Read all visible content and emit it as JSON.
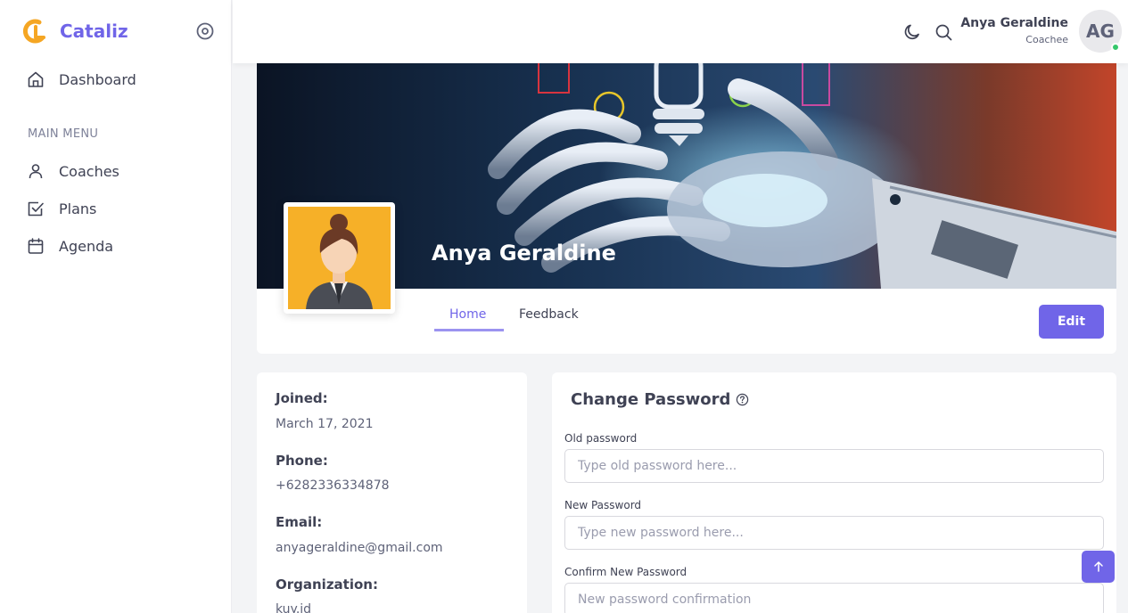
{
  "brand": {
    "name": "Cataliz",
    "primary_color": "#7065e8",
    "logo_color": "#f5a623"
  },
  "sidebar": {
    "dashboard_label": "Dashboard",
    "menu_heading": "MAIN MENU",
    "items": [
      {
        "label": "Coaches",
        "icon": "user-icon"
      },
      {
        "label": "Plans",
        "icon": "check-square-icon"
      },
      {
        "label": "Agenda",
        "icon": "calendar-icon"
      }
    ]
  },
  "topbar": {
    "user_name": "Anya Geraldine",
    "user_role": "Coachee",
    "avatar_initials": "AG",
    "status_color": "#35c76b"
  },
  "profile": {
    "name": "Anya Geraldine",
    "tabs": [
      "Home",
      "Feedback"
    ],
    "active_tab": "Home",
    "edit_label": "Edit"
  },
  "info": {
    "joined_label": "Joined:",
    "joined_value": "March 17, 2021",
    "phone_label": "Phone:",
    "phone_value": "+6282336334878",
    "email_label": "Email:",
    "email_value": "anyageraldine@gmail.com",
    "organization_label": "Organization:",
    "organization_value": "kuy.id"
  },
  "password": {
    "title": "Change Password",
    "old_label": "Old password",
    "old_placeholder": "Type old password here...",
    "new_label": "New Password",
    "new_placeholder": "Type new password here...",
    "confirm_label": "Confirm New Password",
    "confirm_placeholder": "New password confirmation"
  }
}
